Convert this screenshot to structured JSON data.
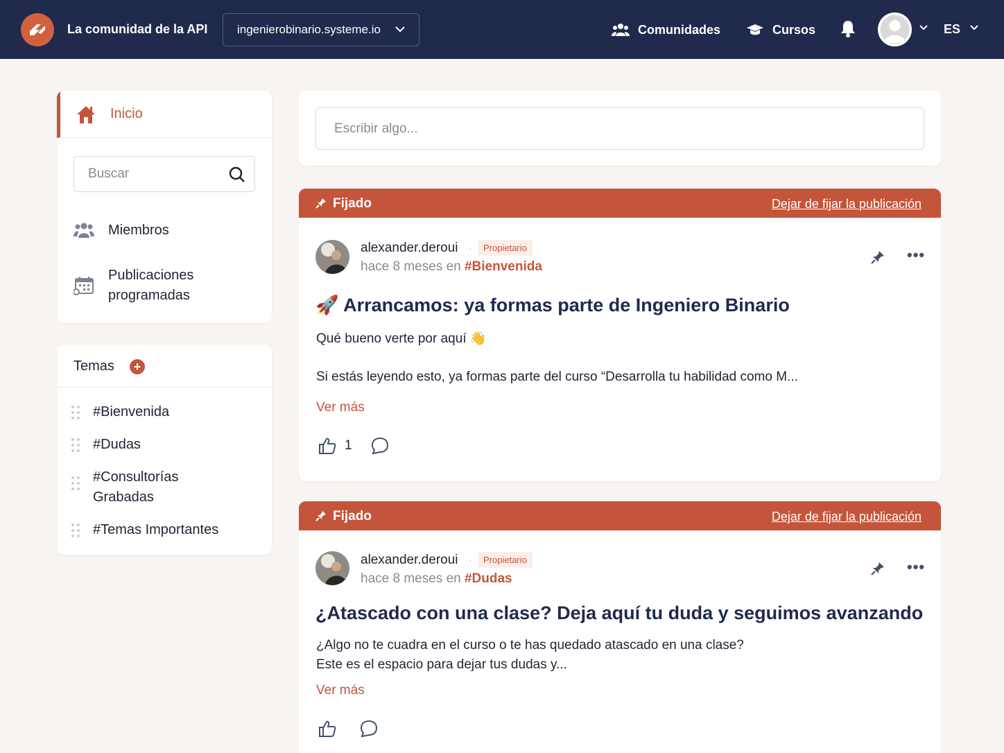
{
  "header": {
    "app_title": "La comunidad de la API",
    "community_selector": "ingenierobinario.systeme.io",
    "nav": [
      {
        "label": "Comunidades",
        "icon": "users-icon"
      },
      {
        "label": "Cursos",
        "icon": "graduation-cap-icon"
      }
    ],
    "language": "ES"
  },
  "sidebar": {
    "home_label": "Inicio",
    "search_placeholder": "Buscar",
    "links": [
      {
        "label": "Miembros",
        "icon": "users-icon"
      },
      {
        "label": "Publicaciones programadas",
        "icon": "calendar-icon"
      }
    ],
    "topics_title": "Temas",
    "topics": [
      "#Bienvenida",
      "#Dudas",
      "#Consultorías Grabadas",
      "#Temas Importantes"
    ]
  },
  "composer": {
    "placeholder": "Escribir algo..."
  },
  "posts": [
    {
      "pinned_label": "Fijado",
      "unpin_label": "Dejar de fijar la publicación",
      "author": "alexander.deroui",
      "separator": "·",
      "role": "Propietario",
      "time": "hace 8 meses en",
      "topic": "#Bienvenida",
      "title_emoji": "🚀",
      "title": "Arrancamos: ya formas parte de Ingeniero Binario",
      "lines": [
        "Qué bueno verte por aquí 👋",
        "Si estás leyendo esto, ya formas parte del curso “Desarrolla tu habilidad como M..."
      ],
      "see_more": "Ver más",
      "likes": "1"
    },
    {
      "pinned_label": "Fijado",
      "unpin_label": "Dejar de fijar la publicación",
      "author": "alexander.deroui",
      "separator": "·",
      "role": "Propietario",
      "time": "hace 8 meses en",
      "topic": "#Dudas",
      "title": "¿Atascado con una clase? Deja aquí tu duda y seguimos avanzando",
      "lines": [
        "¿Algo no te cuadra en el curso o te has quedado atascado en una clase?",
        "Este es el espacio para dejar tus dudas y..."
      ],
      "see_more": "Ver más"
    }
  ],
  "colors": {
    "header_bg": "#1f2a4d",
    "accent": "#c4553a",
    "page_bg": "#f7f4f2"
  }
}
